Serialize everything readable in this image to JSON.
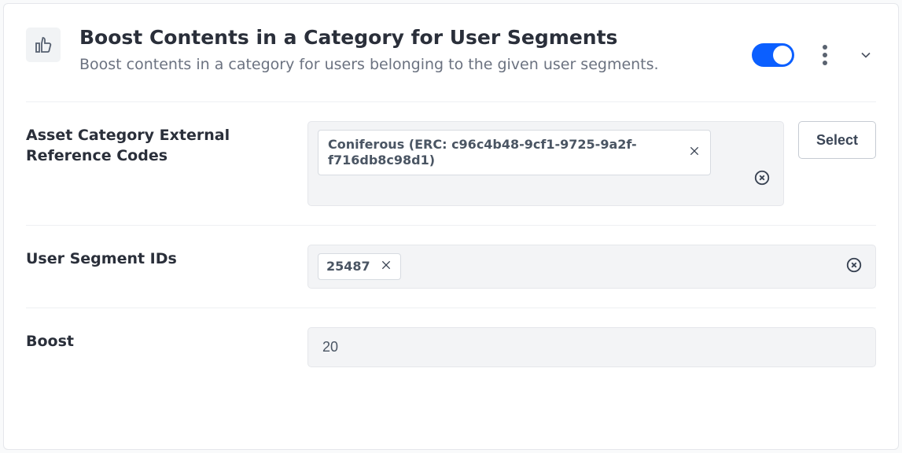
{
  "header": {
    "title": "Boost Contents in a Category for User Segments",
    "description": "Boost contents in a category for users belonging to the given user segments."
  },
  "fields": {
    "assetCategory": {
      "label": "Asset Category External Reference Codes",
      "chip": "Coniferous (ERC: c96c4b48-9cf1-9725-9a2f-f716db8c98d1)",
      "selectLabel": "Select"
    },
    "userSegments": {
      "label": "User Segment IDs",
      "chip": "25487"
    },
    "boost": {
      "label": "Boost",
      "value": "20"
    }
  }
}
